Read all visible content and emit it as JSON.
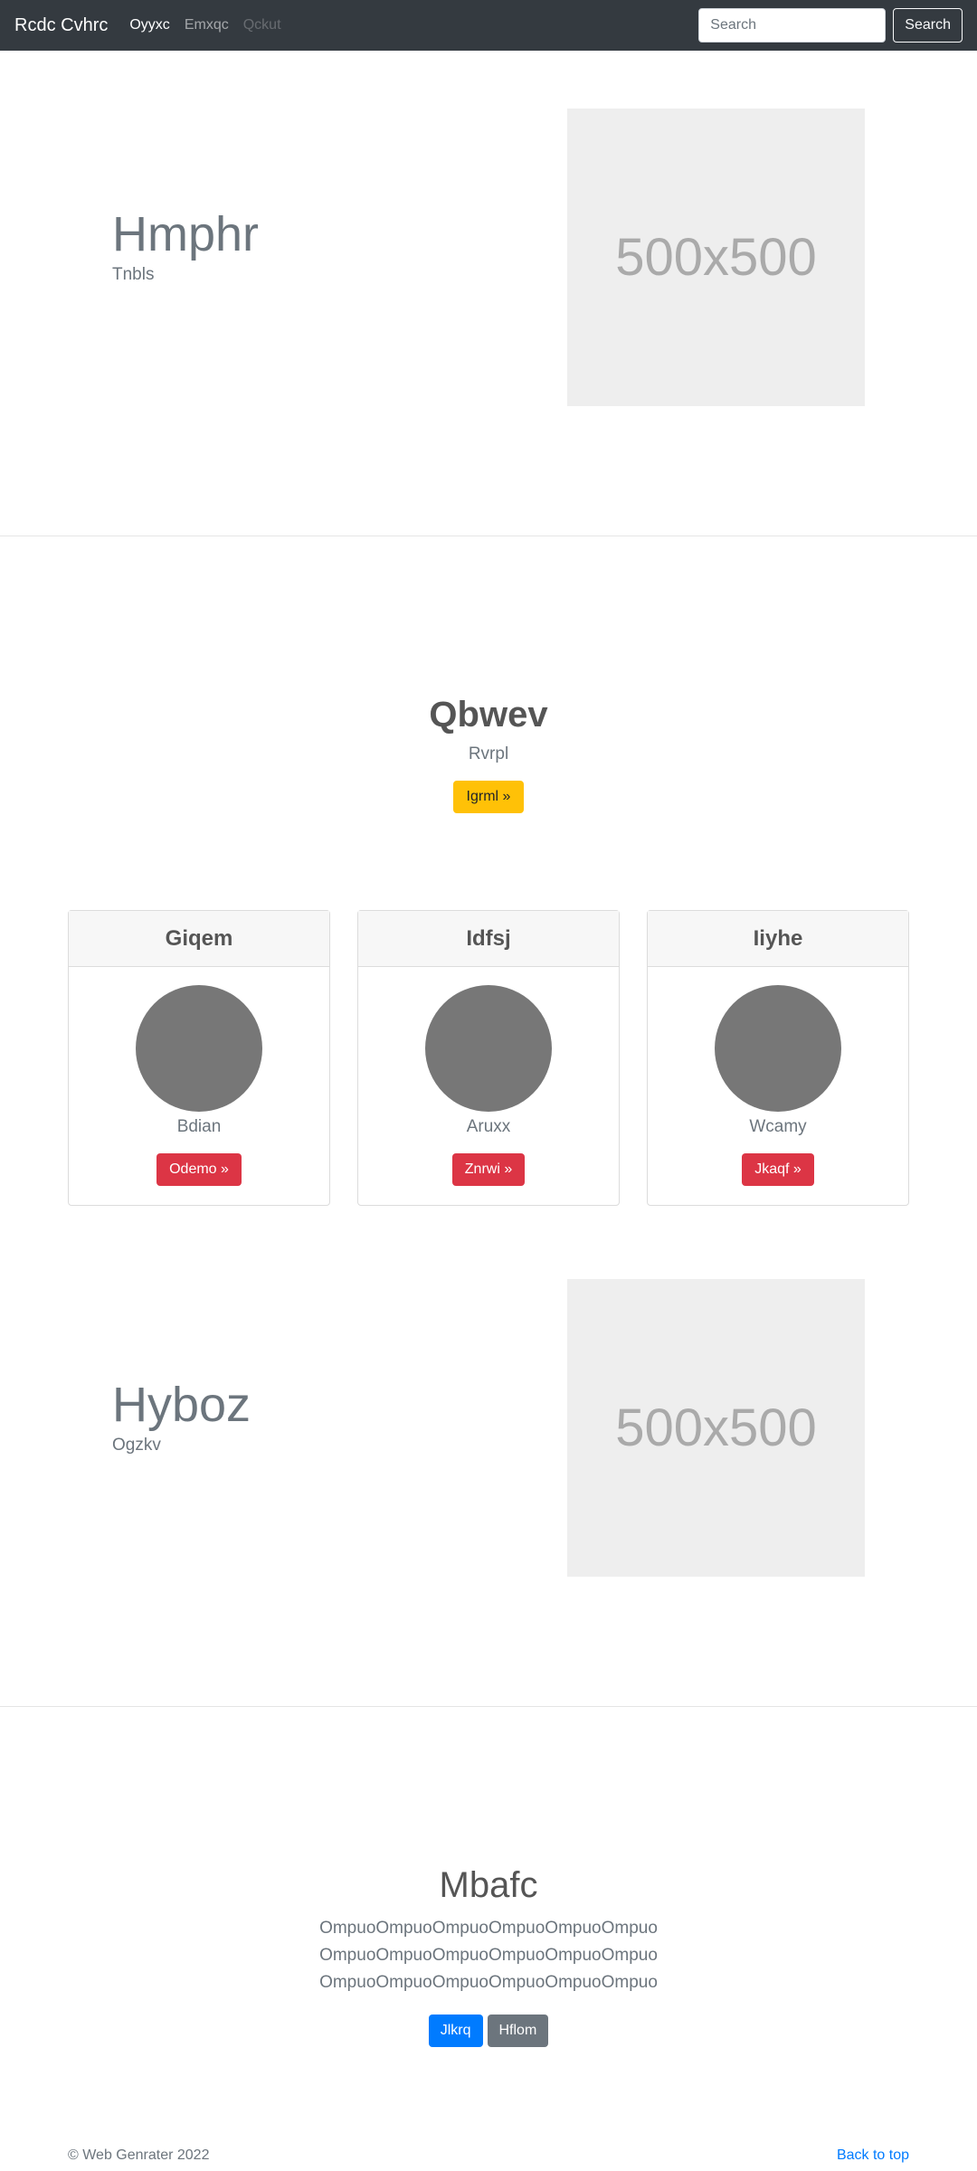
{
  "navbar": {
    "brand": "Rcdc Cvhrc",
    "links": [
      {
        "label": "Oyyxc",
        "state": "active"
      },
      {
        "label": "Emxqc",
        "state": "normal"
      },
      {
        "label": "Qckut",
        "state": "disabled"
      }
    ],
    "search_placeholder": "Search",
    "search_button": "Search"
  },
  "feature1": {
    "heading": "Hmphr",
    "subtext": "Tnbls",
    "image_label": "500x500"
  },
  "pricing": {
    "title": "Qbwev",
    "subtitle": "Rvrpl",
    "button": "Igrml »"
  },
  "cards": [
    {
      "title": "Giqem",
      "text": "Bdian",
      "button": "Odemo »"
    },
    {
      "title": "Idfsj",
      "text": "Aruxx",
      "button": "Znrwi »"
    },
    {
      "title": "Iiyhe",
      "text": "Wcamy",
      "button": "Jkaqf »"
    }
  ],
  "feature2": {
    "heading": "Hyboz",
    "subtext": "Ogzkv",
    "image_label": "500x500"
  },
  "jumbotron": {
    "title": "Mbafc",
    "lines": [
      "OmpuoOmpuoOmpuoOmpuoOmpuoOmpuo",
      "OmpuoOmpuoOmpuoOmpuoOmpuoOmpuo",
      "OmpuoOmpuoOmpuoOmpuoOmpuoOmpuo"
    ],
    "primary_button": "Jlkrq",
    "secondary_button": "Hflom"
  },
  "footer": {
    "copyright": "© Web Genrater 2022",
    "back_to_top": "Back to top"
  },
  "colors": {
    "navbar_bg": "#343a40",
    "warning": "#ffc107",
    "danger": "#dc3545",
    "primary": "#007bff",
    "secondary": "#6c757d",
    "placeholder_bg": "#eeeeee",
    "avatar": "#777777"
  }
}
